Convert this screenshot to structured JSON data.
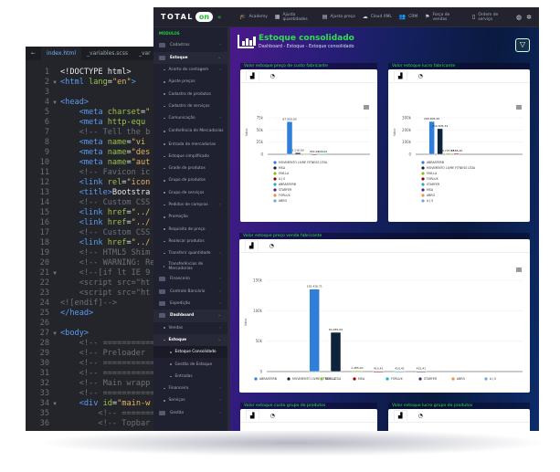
{
  "editor": {
    "tabs": [
      "index.html",
      "_variables.scss",
      "_var"
    ],
    "lines": [
      [
        [
          "t-txt",
          "<!DOCTYPE html>"
        ]
      ],
      [
        [
          "t-tag",
          "<html "
        ],
        [
          "t-attr",
          "lang"
        ],
        [
          "t-txt",
          "="
        ],
        [
          "t-str",
          "\"en\""
        ],
        [
          "t-tag",
          ">"
        ]
      ],
      [],
      [
        [
          "t-tag",
          "<head>"
        ]
      ],
      [
        [
          "t-tag",
          "    <meta "
        ],
        [
          "t-attr",
          "charset"
        ],
        [
          "t-txt",
          "="
        ],
        [
          "t-str",
          "\""
        ]
      ],
      [
        [
          "t-tag",
          "    <meta "
        ],
        [
          "t-attr",
          "http-equ"
        ]
      ],
      [
        [
          "t-com",
          "    <!-- Tell the b"
        ]
      ],
      [
        [
          "t-tag",
          "    <meta "
        ],
        [
          "t-attr",
          "name"
        ],
        [
          "t-txt",
          "="
        ],
        [
          "t-str",
          "\"vi"
        ]
      ],
      [
        [
          "t-tag",
          "    <meta "
        ],
        [
          "t-attr",
          "name"
        ],
        [
          "t-txt",
          "="
        ],
        [
          "t-str",
          "\"des"
        ]
      ],
      [
        [
          "t-tag",
          "    <meta "
        ],
        [
          "t-attr",
          "name"
        ],
        [
          "t-txt",
          "="
        ],
        [
          "t-str",
          "\"aut"
        ]
      ],
      [
        [
          "t-com",
          "    <!-- Favicon ic"
        ]
      ],
      [
        [
          "t-tag",
          "    <link "
        ],
        [
          "t-attr",
          "rel"
        ],
        [
          "t-txt",
          "="
        ],
        [
          "t-str",
          "\"icon"
        ]
      ],
      [
        [
          "t-tag",
          "    <title>"
        ],
        [
          "t-txt",
          "Bootstra"
        ]
      ],
      [
        [
          "t-com",
          "    <!-- Custom CSS"
        ]
      ],
      [
        [
          "t-tag",
          "    <link "
        ],
        [
          "t-attr",
          "href"
        ],
        [
          "t-txt",
          "="
        ],
        [
          "t-str",
          "\"../"
        ]
      ],
      [
        [
          "t-tag",
          "    <link "
        ],
        [
          "t-attr",
          "href"
        ],
        [
          "t-txt",
          "="
        ],
        [
          "t-str",
          "\"../"
        ]
      ],
      [
        [
          "t-com",
          "    <!-- Custom CSS"
        ]
      ],
      [
        [
          "t-tag",
          "    <link "
        ],
        [
          "t-attr",
          "href"
        ],
        [
          "t-txt",
          "="
        ],
        [
          "t-str",
          "\"../"
        ]
      ],
      [
        [
          "t-com",
          "    <!-- HTML5 Shim"
        ]
      ],
      [
        [
          "t-com",
          "    <!-- WARNING: Re"
        ]
      ],
      [
        [
          "t-com",
          "    <!--[if lt IE 9"
        ]
      ],
      [
        [
          "t-com",
          "    <script src=\"ht"
        ]
      ],
      [
        [
          "t-com",
          "    <script src=\"ht"
        ]
      ],
      [
        [
          "t-com",
          "<![endif]-->"
        ]
      ],
      [
        [
          "t-tag",
          "</head>"
        ]
      ],
      [],
      [
        [
          "t-tag",
          "<body>"
        ]
      ],
      [
        [
          "t-com",
          "    <!-- ==========="
        ]
      ],
      [
        [
          "t-com",
          "    <!-- Preloader"
        ]
      ],
      [
        [
          "t-com",
          "    <!-- ==========="
        ]
      ],
      [
        [
          "t-com",
          "    <!-- ==========="
        ]
      ],
      [
        [
          "t-com",
          "    <!-- Main wrapp"
        ]
      ],
      [
        [
          "t-com",
          "    <!-- ==========="
        ]
      ],
      [
        [
          "t-tag",
          "    <div "
        ],
        [
          "t-attr",
          "id"
        ],
        [
          "t-txt",
          "="
        ],
        [
          "t-str",
          "\"main-w"
        ]
      ],
      [
        [
          "t-com",
          "        <!-- ======="
        ]
      ],
      [
        [
          "t-com",
          "        <!-- Topbar"
        ]
      ]
    ],
    "folds": [
      2,
      4,
      21,
      27,
      34
    ]
  },
  "topbar": {
    "logo_text": "TOTAL",
    "logo_on": "on",
    "nav": [
      {
        "icon": "academy-icon",
        "glyph": "🎓",
        "label": "Academy"
      },
      {
        "icon": "quantities-icon",
        "glyph": "▦",
        "label": "Ajusta quantidades"
      },
      {
        "icon": "prices-icon",
        "glyph": "▤",
        "label": "Ajusta preço"
      },
      {
        "icon": "cloud-icon",
        "glyph": "☁",
        "label": "Cloud XML"
      },
      {
        "icon": "crm-icon",
        "glyph": "👥",
        "label": "CRM"
      },
      {
        "icon": "sales-force-icon",
        "glyph": "⚑",
        "label": "Força de vendas"
      },
      {
        "icon": "service-order-icon",
        "glyph": "▯",
        "label": "Ordem de serviço"
      }
    ]
  },
  "sidebar": {
    "items": [
      {
        "label": "MÓDULOS",
        "type": "head"
      },
      {
        "label": "Cadastros",
        "type": "top",
        "chev": "›"
      },
      {
        "label": "Estoque",
        "type": "top active",
        "chev": "⌄"
      },
      {
        "label": "Acerto de contagem",
        "type": "sub",
        "chev": "›"
      },
      {
        "label": "Ajuste preços",
        "type": "sub"
      },
      {
        "label": "Cadastro de produtos",
        "type": "sub"
      },
      {
        "label": "Cadastro de serviços",
        "type": "sub"
      },
      {
        "label": "Comunicação",
        "type": "sub",
        "chev": "›"
      },
      {
        "label": "Conferência de Mercadorias",
        "type": "sub two"
      },
      {
        "label": "Entrada de mercadorias",
        "type": "sub"
      },
      {
        "label": "Estoque simplificado",
        "type": "sub"
      },
      {
        "label": "Grade de produtos",
        "type": "sub"
      },
      {
        "label": "Grupo de produtos",
        "type": "sub"
      },
      {
        "label": "Grupo de serviços",
        "type": "sub"
      },
      {
        "label": "Pedidos de compras",
        "type": "sub",
        "chev": "›"
      },
      {
        "label": "Promoção",
        "type": "sub"
      },
      {
        "label": "Requisita de preço",
        "type": "sub"
      },
      {
        "label": "Realocar produtos",
        "type": "sub"
      },
      {
        "label": "Transferir quantidade",
        "type": "sub",
        "chev": "›"
      },
      {
        "label": "Transferências de Mercadorias",
        "type": "sub two"
      },
      {
        "label": "Financeiro",
        "type": "top",
        "chev": "›"
      },
      {
        "label": "Controle Bancário",
        "type": "top",
        "chev": "›"
      },
      {
        "label": "Expedição",
        "type": "top",
        "chev": "›"
      },
      {
        "label": "Dashboard",
        "type": "top active",
        "chev": "⌄"
      },
      {
        "label": "Vendas",
        "type": "sub",
        "chev": "›"
      },
      {
        "label": "Estoque",
        "type": "sub active",
        "chev": "⌄"
      },
      {
        "label": "Estoque Consolidado",
        "type": "sub2 cur"
      },
      {
        "label": "Gestão de Estoque",
        "type": "sub2"
      },
      {
        "label": "Entradas",
        "type": "sub2"
      },
      {
        "label": "Financeiro",
        "type": "sub",
        "chev": "›"
      },
      {
        "label": "Serviços",
        "type": "sub",
        "chev": "›"
      },
      {
        "label": "Gestão",
        "type": "top",
        "chev": "›"
      }
    ]
  },
  "page": {
    "title": "Estoque consolidado",
    "breadcrumb": "Dashboard - Estoque - Estoque consolidado"
  },
  "colors": {
    "accent": "#2ee04a",
    "series": [
      "#2f7ed8",
      "#0d233a",
      "#8bbc21",
      "#910000",
      "#1aadce",
      "#492970",
      "#f28f43",
      "#77a1e5"
    ]
  },
  "chart_data": [
    {
      "type": "bar",
      "title": "Valor estoque preço de custo fabricante",
      "ylabel": "Valor",
      "ylim": [
        0,
        75000
      ],
      "ticks": [
        "0",
        "25k",
        "50k",
        "75k"
      ],
      "tick_values": [
        0,
        25000,
        50000,
        75000
      ],
      "categories": [
        "MOVIMENTO LIVRE FITNESS LTDA",
        "MSA",
        "FAYLLA",
        "A J S",
        "ABRASFERB",
        "STARFER",
        "FORLUX",
        "ABRO"
      ],
      "values": [
        67000,
        3116,
        1000,
        361,
        206,
        0,
        0,
        0
      ],
      "labels": [
        "67.000,00",
        "3.116,00",
        "",
        "361,00",
        "206,00",
        "",
        "",
        ""
      ],
      "legend": "bottom-vertical"
    },
    {
      "type": "bar",
      "title": "Valor estoque lucro fabricante",
      "ylabel": "Valor",
      "ylim": [
        0,
        300000
      ],
      "ticks": [
        "0",
        "100k",
        "200k",
        "300k"
      ],
      "tick_values": [
        0,
        100000,
        200000,
        300000
      ],
      "categories": [
        "ABRASFERB",
        "MOVIMENTO LIVRE FITNESS LTDA",
        "FAYLLA",
        "FORLUX",
        "STARFER",
        "MSA",
        "ABRO",
        "A J S"
      ],
      "values": [
        269605.4,
        210605.34,
        8797.28,
        7586.4,
        0,
        0,
        0,
        0
      ],
      "labels": [
        "269.605,40",
        "210.605,34",
        "8.797,28",
        "7.586,40",
        "",
        "",
        "",
        ""
      ],
      "legend": "bottom-vertical"
    },
    {
      "type": "bar",
      "title": "Valor estoque preço venda fabricante",
      "ylabel": "Valor",
      "ylim": [
        0,
        150000
      ],
      "ticks": [
        "0",
        "50k",
        "100k",
        "150k"
      ],
      "tick_values": [
        0,
        50000,
        100000,
        150000
      ],
      "categories": [
        "ABRASFERB",
        "MOVIMENTO LIVRE FITNESS LTDA",
        "FAYLLA",
        "MSA",
        "FORLUX",
        "STARFER",
        "ABRO",
        "A J S"
      ],
      "values": [
        135416.71,
        64485,
        1485,
        415.41,
        415.41,
        415.41,
        0,
        0
      ],
      "labels": [
        "135.416,71",
        "64.485,00",
        "1.485,00",
        "415,41",
        "415,41",
        "415,41",
        "",
        ""
      ],
      "legend": "bottom-horizontal"
    }
  ],
  "bottom_cards": [
    "Valor estoque custo grupo de produtos",
    "Valor estoque lucro grupo de produtos"
  ]
}
